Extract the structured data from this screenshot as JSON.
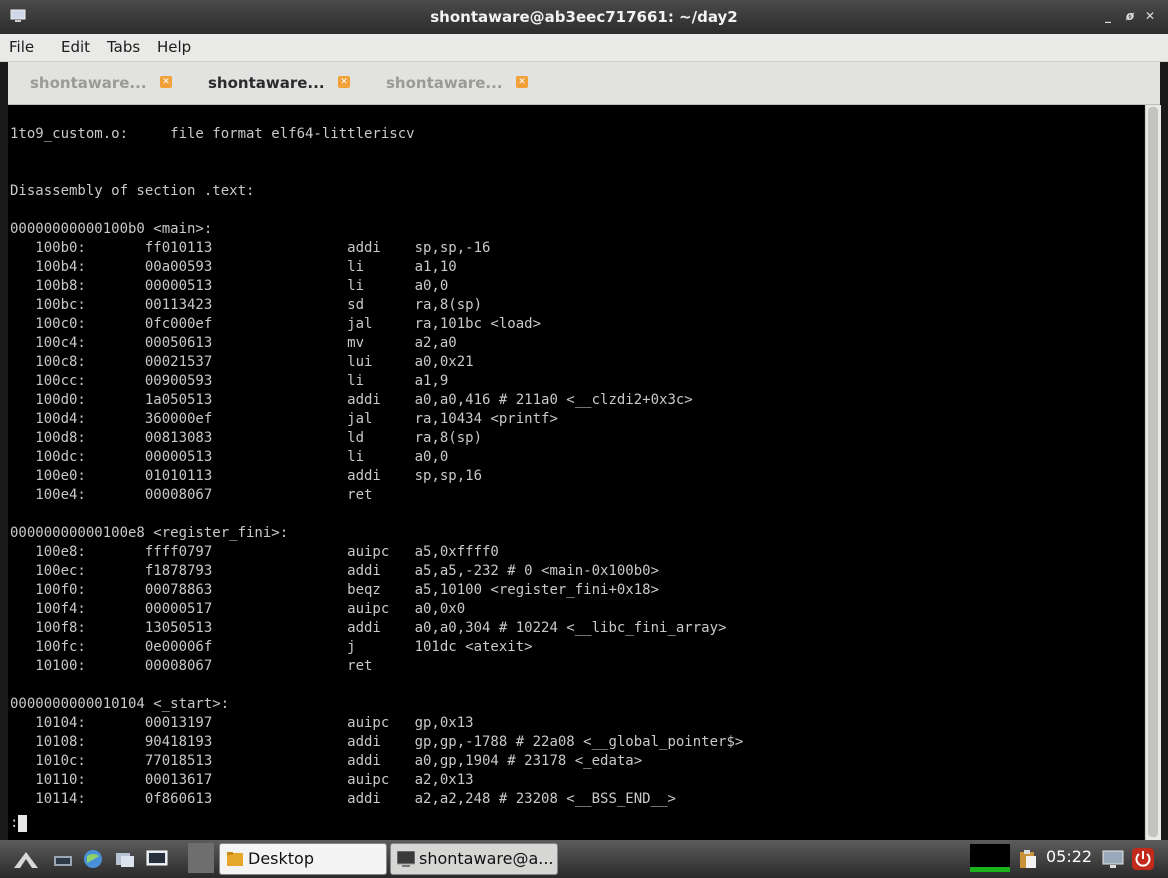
{
  "window": {
    "title": "shontaware@ab3eec717661: ~/day2"
  },
  "menu": [
    "File",
    "Edit",
    "Tabs",
    "Help"
  ],
  "tabs": [
    {
      "label": "shontaware...",
      "active": false
    },
    {
      "label": "shontaware...",
      "active": true
    },
    {
      "label": "shontaware...",
      "active": false
    }
  ],
  "terminal": {
    "lines": [
      "1to9_custom.o:     file format elf64-littleriscv",
      "",
      "",
      "Disassembly of section .text:",
      "",
      "00000000000100b0 <main>:",
      "   100b0:       ff010113                addi    sp,sp,-16",
      "   100b4:       00a00593                li      a1,10",
      "   100b8:       00000513                li      a0,0",
      "   100bc:       00113423                sd      ra,8(sp)",
      "   100c0:       0fc000ef                jal     ra,101bc <load>",
      "   100c4:       00050613                mv      a2,a0",
      "   100c8:       00021537                lui     a0,0x21",
      "   100cc:       00900593                li      a1,9",
      "   100d0:       1a050513                addi    a0,a0,416 # 211a0 <__clzdi2+0x3c>",
      "   100d4:       360000ef                jal     ra,10434 <printf>",
      "   100d8:       00813083                ld      ra,8(sp)",
      "   100dc:       00000513                li      a0,0",
      "   100e0:       01010113                addi    sp,sp,16",
      "   100e4:       00008067                ret",
      "",
      "00000000000100e8 <register_fini>:",
      "   100e8:       ffff0797                auipc   a5,0xffff0",
      "   100ec:       f1878793                addi    a5,a5,-232 # 0 <main-0x100b0>",
      "   100f0:       00078863                beqz    a5,10100 <register_fini+0x18>",
      "   100f4:       00000517                auipc   a0,0x0",
      "   100f8:       13050513                addi    a0,a0,304 # 10224 <__libc_fini_array>",
      "   100fc:       0e00006f                j       101dc <atexit>",
      "   10100:       00008067                ret",
      "",
      "0000000000010104 <_start>:",
      "   10104:       00013197                auipc   gp,0x13",
      "   10108:       90418193                addi    gp,gp,-1788 # 22a08 <__global_pointer$>",
      "   1010c:       77018513                addi    a0,gp,1904 # 23178 <_edata>",
      "   10110:       00013617                auipc   a2,0x13",
      "   10114:       0f860613                addi    a2,a2,248 # 23208 <__BSS_END__>",
      ":"
    ]
  },
  "taskbar": {
    "tasks": [
      {
        "label": "Desktop"
      },
      {
        "label": "shontaware@a..."
      }
    ],
    "clock": "05:22"
  }
}
